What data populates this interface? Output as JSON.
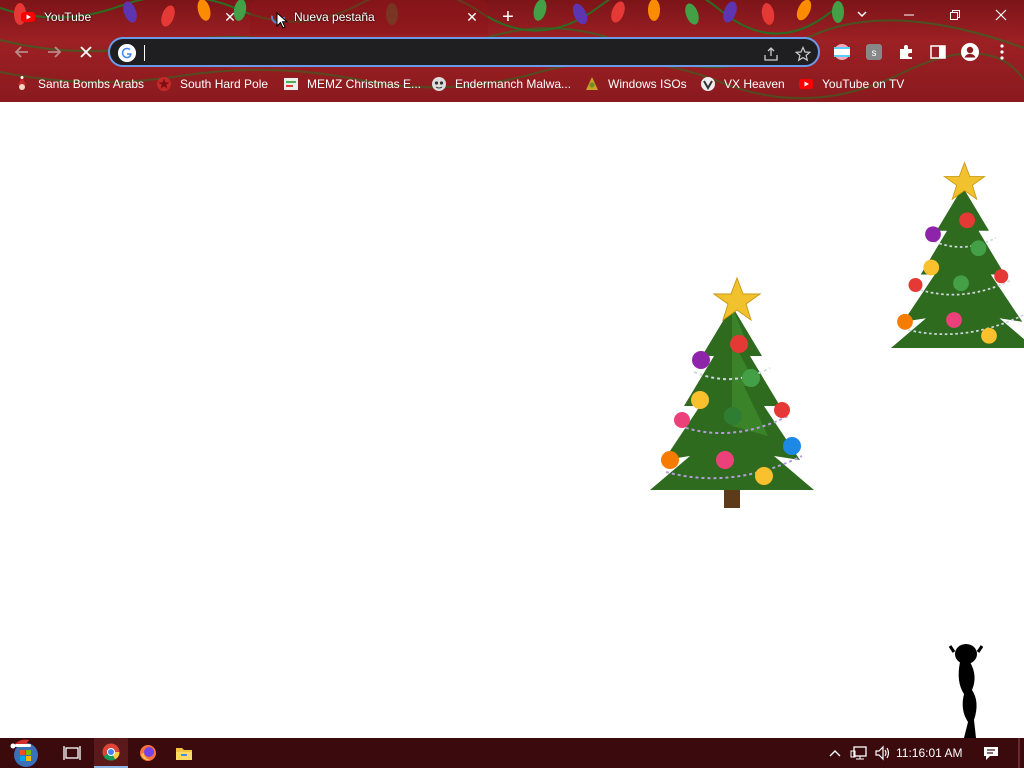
{
  "tabs": [
    {
      "title": "YouTube",
      "active": false,
      "favicon": "youtube-icon"
    },
    {
      "title": "Nueva pestaña",
      "active": true,
      "favicon": "loading-icon"
    }
  ],
  "toolbar": {
    "url_value": "",
    "search_engine_icon": "google-icon"
  },
  "bookmarks": [
    {
      "label": "Santa Bombs Arabs",
      "icon": "santa-icon"
    },
    {
      "label": "South Hard Pole",
      "icon": "red-star-icon"
    },
    {
      "label": "MEMZ Christmas E...",
      "icon": "memz-icon"
    },
    {
      "label": "Endermanch Malwa...",
      "icon": "endermanch-icon"
    },
    {
      "label": "Windows ISOs",
      "icon": "windows-iso-icon"
    },
    {
      "label": "VX Heaven",
      "icon": "vx-heaven-icon"
    },
    {
      "label": "YouTube on TV",
      "icon": "youtube-icon"
    }
  ],
  "taskbar": {
    "clock": "11:16:01 AM",
    "pinned": [
      "start-orb-icon",
      "task-view-icon",
      "chrome-icon",
      "firefox-icon",
      "file-explorer-icon"
    ]
  },
  "colors": {
    "chrome_bg": "#8a1a1e",
    "omnibox_border": "#6b9be8",
    "taskbar_bg": "#3a0a0c"
  }
}
